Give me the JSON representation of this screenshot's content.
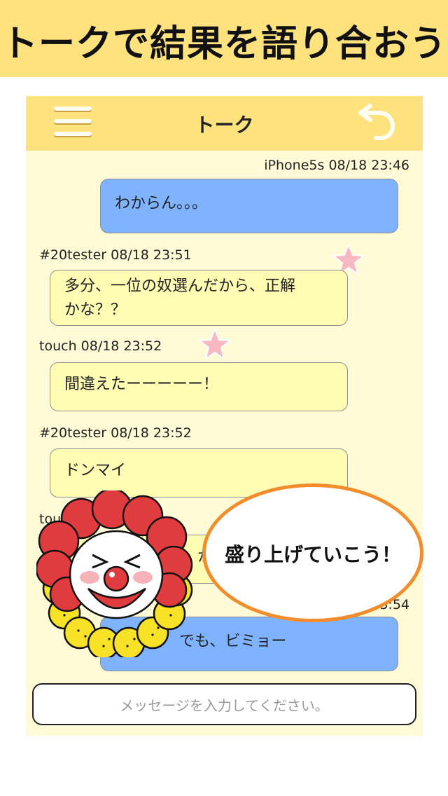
{
  "banner": {
    "title": "トークで結果を語り合おう"
  },
  "navbar": {
    "title": "トーク",
    "menu_icon": "hamburger-icon",
    "back_icon": "undo-arrow-icon"
  },
  "messages": [
    {
      "sender_time": "iPhone5s 08/18 23:46",
      "text": "わからん。。。",
      "mine": true
    },
    {
      "sender_time": "#20tester 08/18 23:51",
      "text_line1": "多分、一位の奴選んだから、正解",
      "text_line2": "かな？？",
      "mine": false
    },
    {
      "sender_time": "touch 08/18 23:52",
      "text": "間違えたーーーーー！",
      "mine": false
    },
    {
      "sender_time": "#20tester 08/18 23:52",
      "text": "ドンマイ",
      "mine": false
    },
    {
      "sender_time": "tou",
      "text": "か",
      "mine": false
    },
    {
      "sender_time": "3:54",
      "text": "でも、ビミョー",
      "mine": true
    }
  ],
  "input": {
    "placeholder": "メッセージを入力してください。"
  },
  "mascot": {
    "speech": "盛り上げていこう！"
  },
  "colors": {
    "banner": "#fde27e",
    "mine_bubble": "#7fb3ff",
    "other_bubble": "#fffcb3",
    "speech_border": "#f38c2a"
  }
}
